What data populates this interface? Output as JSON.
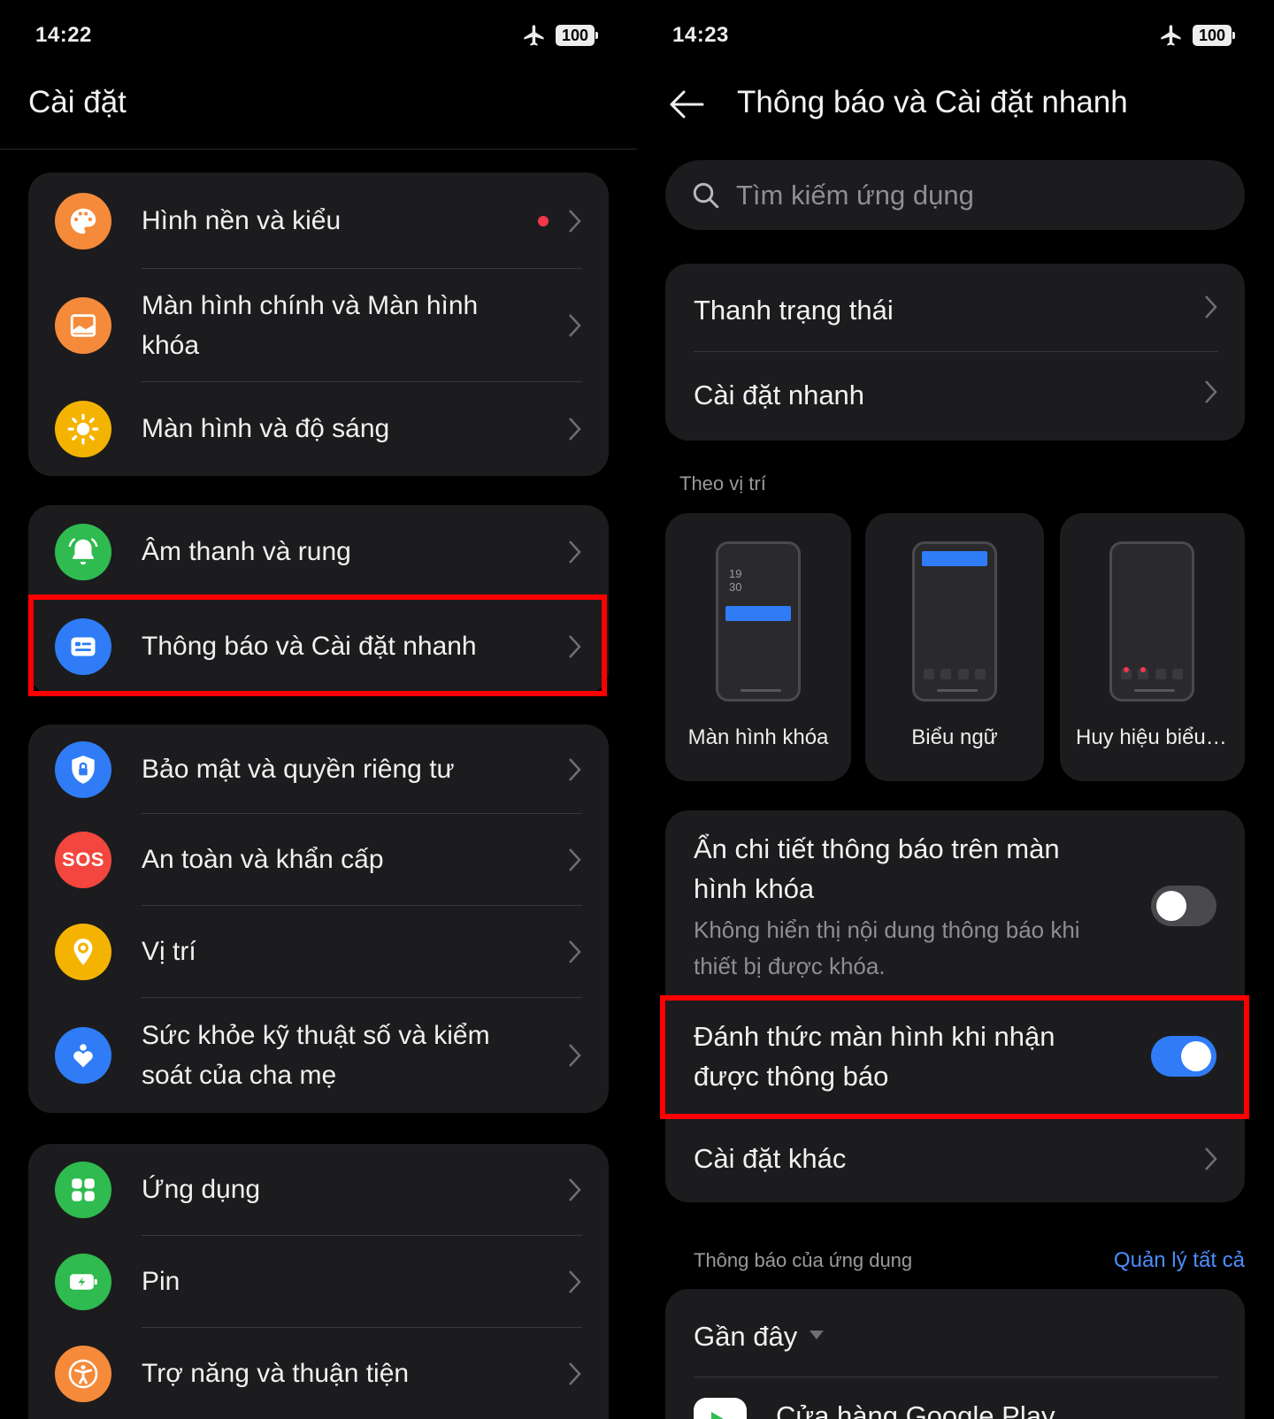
{
  "left": {
    "status": {
      "time": "14:22",
      "battery": "100"
    },
    "title": "Cài đặt",
    "groups": [
      {
        "items": [
          {
            "label": "Hình nền và kiểu",
            "icon": "palette-icon",
            "color": "#f58a3a",
            "badge": true
          },
          {
            "label": "Màn hình chính và Màn hình khóa",
            "icon": "home-screen-icon",
            "color": "#f58a3a"
          },
          {
            "label": "Màn hình và độ sáng",
            "icon": "brightness-icon",
            "color": "#f4b300"
          }
        ]
      },
      {
        "items": [
          {
            "label": "Âm thanh và rung",
            "icon": "bell-icon",
            "color": "#2fbb4f"
          },
          {
            "label": "Thông báo và Cài đặt nhanh",
            "icon": "notification-icon",
            "color": "#2f7cf6",
            "highlighted": true
          }
        ]
      },
      {
        "items": [
          {
            "label": "Bảo mật và quyền riêng tư",
            "icon": "shield-lock-icon",
            "color": "#2f7cf6"
          },
          {
            "label": "An toàn và khẩn cấp",
            "icon": "sos-icon",
            "color": "#f2463e",
            "text": "SOS"
          },
          {
            "label": "Vị trí",
            "icon": "location-icon",
            "color": "#f4b300"
          },
          {
            "label": "Sức khỏe kỹ thuật số và kiểm soát của cha mẹ",
            "icon": "digital-wellbeing-icon",
            "color": "#2f7cf6"
          }
        ]
      },
      {
        "items": [
          {
            "label": "Ứng dụng",
            "icon": "apps-grid-icon",
            "color": "#2fbb4f"
          },
          {
            "label": "Pin",
            "icon": "battery-icon",
            "color": "#2fbb4f"
          },
          {
            "label": "Trợ năng và thuận tiện",
            "icon": "accessibility-icon",
            "color": "#f58a3a"
          }
        ]
      }
    ]
  },
  "right": {
    "status": {
      "time": "14:23",
      "battery": "100"
    },
    "title": "Thông báo và Cài đặt nhanh",
    "search_placeholder": "Tìm kiếm ứng dụng",
    "group1": [
      "Thanh trạng thái",
      "Cài đặt nhanh"
    ],
    "position_section": "Theo vị trí",
    "positions": [
      {
        "label": "Màn hình khóa",
        "clock": [
          "19",
          "30"
        ]
      },
      {
        "label": "Biểu ngữ"
      },
      {
        "label": "Huy hiệu biểu tượng"
      }
    ],
    "hide_details": {
      "label": "Ẩn chi tiết thông báo trên màn hình khóa",
      "sub": "Không hiển thị nội dung thông báo khi thiết bị được khóa.",
      "enabled": false
    },
    "wake_screen": {
      "label": "Đánh thức màn hình khi nhận được thông báo",
      "enabled": true
    },
    "other_settings": "Cài đặt khác",
    "app_notif_section": "Thông báo của ứng dụng",
    "manage_all": "Quản lý tất cả",
    "recent": "Gần đây",
    "first_app": "Cửa hàng Google Play",
    "colors": {
      "accent": "#2f7cf6",
      "highlight": "#ff0000",
      "card": "#1c1c1e"
    }
  }
}
